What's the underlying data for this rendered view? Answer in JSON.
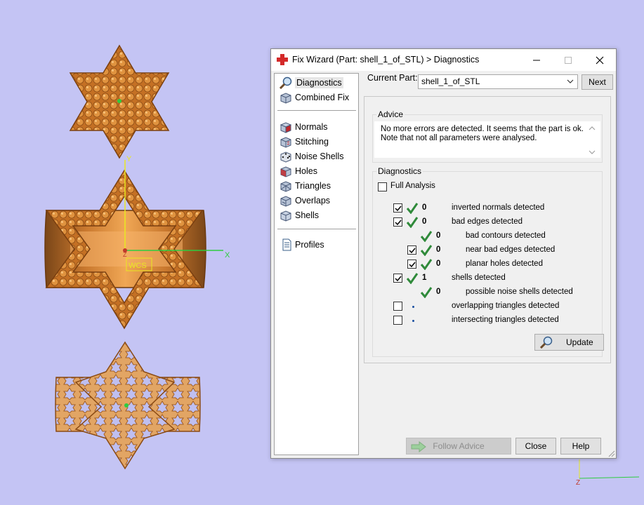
{
  "window": {
    "title": "Fix Wizard (Part: shell_1_of_STL) > Diagnostics"
  },
  "nav": {
    "items": [
      {
        "label": "Diagnostics",
        "icon": "magnifier-icon",
        "selected": true
      },
      {
        "label": "Combined Fix",
        "icon": "cube-stack-icon"
      },
      {
        "label": "Normals",
        "icon": "cube-red-face-icon"
      },
      {
        "label": "Stitching",
        "icon": "cube-stitch-icon"
      },
      {
        "label": "Noise Shells",
        "icon": "dice-icon"
      },
      {
        "label": "Holes",
        "icon": "cube-hole-icon"
      },
      {
        "label": "Triangles",
        "icon": "cube-triangle-icon"
      },
      {
        "label": "Overlaps",
        "icon": "cube-overlap-icon"
      },
      {
        "label": "Shells",
        "icon": "cube-shells-icon"
      },
      {
        "label": "Profiles",
        "icon": "document-icon"
      }
    ]
  },
  "current_part": {
    "label": "Current Part:",
    "value": "shell_1_of_STL",
    "next_label": "Next"
  },
  "advice": {
    "title": "Advice",
    "line1": "No more errors are detected. It seems that the part is ok.",
    "line2": "Note that not all parameters were analysed."
  },
  "diagnostics": {
    "title": "Diagnostics",
    "full_analysis_label": "Full Analysis",
    "full_analysis_checked": false,
    "rows": [
      {
        "label": "inverted normals detected",
        "count": "0",
        "checked": true,
        "has_checkbox": true,
        "indent": 0,
        "status": "ok"
      },
      {
        "label": "bad edges detected",
        "count": "0",
        "checked": true,
        "has_checkbox": true,
        "indent": 0,
        "status": "ok"
      },
      {
        "label": "bad contours detected",
        "count": "0",
        "checked": false,
        "has_checkbox": false,
        "indent": 1,
        "status": "ok"
      },
      {
        "label": "near bad edges detected",
        "count": "0",
        "checked": true,
        "has_checkbox": true,
        "indent": 1,
        "status": "ok"
      },
      {
        "label": "planar holes detected",
        "count": "0",
        "checked": true,
        "has_checkbox": true,
        "indent": 1,
        "status": "ok"
      },
      {
        "label": "shells detected",
        "count": "1",
        "checked": true,
        "has_checkbox": true,
        "indent": 0,
        "status": "ok"
      },
      {
        "label": "possible noise shells detected",
        "count": "0",
        "checked": false,
        "has_checkbox": false,
        "indent": 1,
        "status": "ok"
      },
      {
        "label": "overlapping triangles detected",
        "count": "",
        "checked": false,
        "has_checkbox": true,
        "indent": 0,
        "status": "unknown"
      },
      {
        "label": "intersecting triangles detected",
        "count": "",
        "checked": false,
        "has_checkbox": true,
        "indent": 0,
        "status": "unknown"
      }
    ],
    "update_label": "Update"
  },
  "footer": {
    "follow_advice_label": "Follow Advice",
    "close_label": "Close",
    "help_label": "Help"
  },
  "viewport": {
    "axis_x_label": "X",
    "axis_y_label": "Y",
    "axis_z_label": "Z",
    "wcs_label": "WCS"
  },
  "colors": {
    "background": "#c4c4f4",
    "gold": "#d98a3c",
    "ok_check": "#2f8a3a",
    "axis_x": "#2ecc40",
    "axis_y": "#e8e820"
  }
}
